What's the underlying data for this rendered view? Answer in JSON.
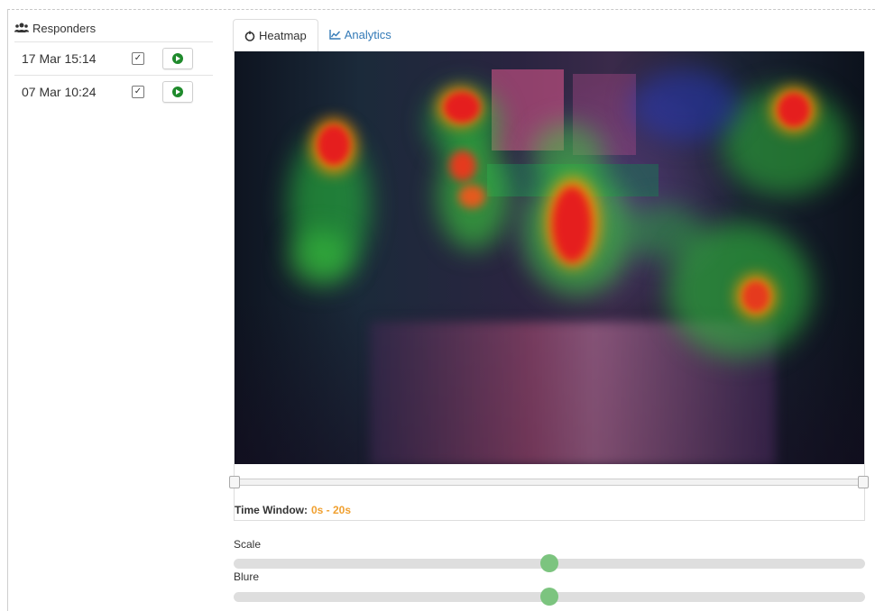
{
  "sidebar": {
    "title": "Responders",
    "responders": [
      {
        "date": "17 Mar 15:14",
        "checked": true
      },
      {
        "date": "07 Mar 10:24",
        "checked": true
      }
    ]
  },
  "tabs": [
    {
      "label": "Heatmap",
      "active": true,
      "icon": "heatmap-icon"
    },
    {
      "label": "Analytics",
      "active": false,
      "icon": "line-chart-icon"
    }
  ],
  "time_window": {
    "label": "Time Window:",
    "value": "0s - 20s"
  },
  "scale": {
    "label": "Scale",
    "value": 0.5
  },
  "blure": {
    "label": "Blure",
    "value": 0.5
  },
  "colors": {
    "accent": "#337ab7",
    "play": "#1f8a2c",
    "time_value": "#f0a030",
    "slider_thumb": "#7cc47f"
  }
}
